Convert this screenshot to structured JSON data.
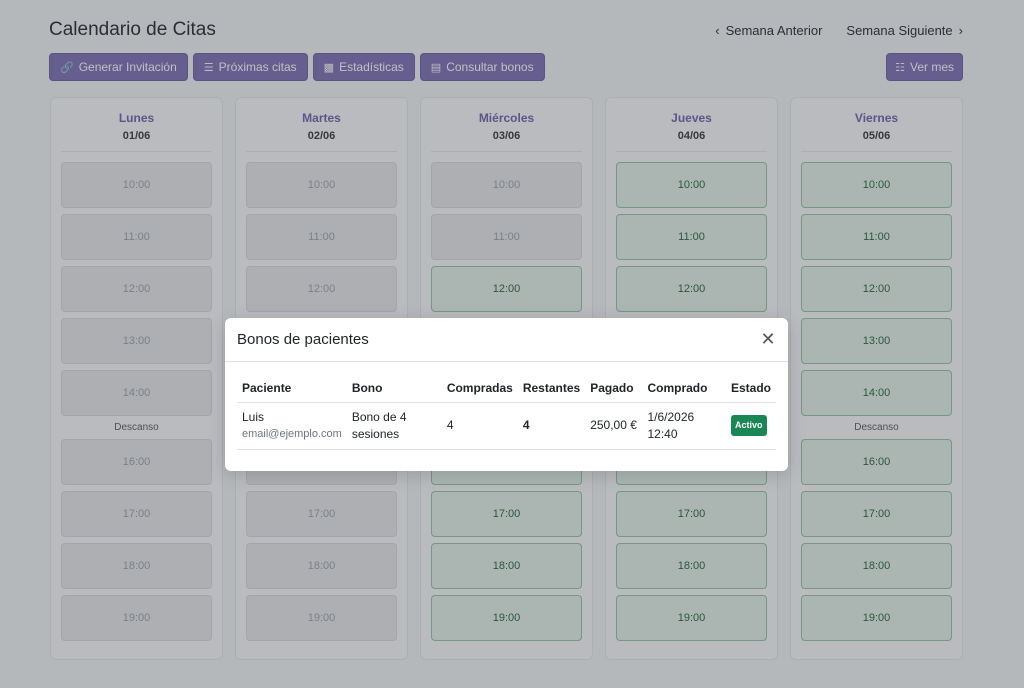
{
  "header": {
    "title": "Calendario de Citas",
    "prev_week": "Semana Anterior",
    "next_week": "Semana Siguiente"
  },
  "toolbar": {
    "buttons": [
      {
        "label": "Generar Invitación",
        "icon": "link-icon"
      },
      {
        "label": "Próximas citas",
        "icon": "list-icon"
      },
      {
        "label": "Estadísticas",
        "icon": "bar-chart-icon"
      },
      {
        "label": "Consultar bonos",
        "icon": "card-icon"
      }
    ],
    "month_button": {
      "label": "Ver mes",
      "icon": "calendar-icon"
    }
  },
  "calendar": {
    "days": [
      {
        "name": "Lunes",
        "date": "01/06"
      },
      {
        "name": "Martes",
        "date": "02/06"
      },
      {
        "name": "Miércoles",
        "date": "03/06"
      },
      {
        "name": "Jueves",
        "date": "04/06"
      },
      {
        "name": "Viernes",
        "date": "05/06"
      }
    ],
    "break_label": "Descanso",
    "times": [
      "10:00",
      "11:00",
      "12:00",
      "13:00",
      "14:00",
      "16:00",
      "17:00",
      "18:00",
      "19:00"
    ],
    "colors": {
      "available_bg": "#e1efe6",
      "available_text": "#26603a",
      "unavailable_bg": "#e4e5e8",
      "accent": "#7b6cb0"
    }
  },
  "modal": {
    "title": "Bonos de pacientes",
    "columns": [
      "Paciente",
      "Bono",
      "Compradas",
      "Restantes",
      "Pagado",
      "Comprado",
      "Estado"
    ],
    "rows": [
      {
        "patient_name": "Luis",
        "patient_email": "email@ejemplo.com",
        "bono": "Bono de 4 sesiones",
        "purchased": "4",
        "remaining": "4",
        "paid": "250,00 €",
        "purchase_date": "1/6/2026 12:40",
        "status": "Activo"
      }
    ]
  }
}
